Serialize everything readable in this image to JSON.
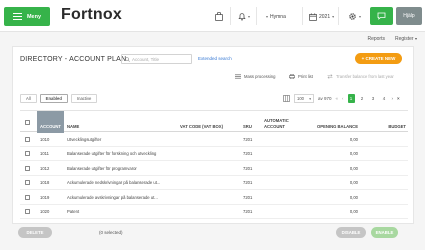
{
  "header": {
    "menu_label": "Meny",
    "logo": "Fortnox",
    "user": "Hymna",
    "year": "2021",
    "help_label": "Hjälp"
  },
  "sublinks": {
    "reports": "Reports",
    "register": "Register"
  },
  "page": {
    "title": "DIRECTORY - ACCOUNT PLAN",
    "search_placeholder": "Account, Title",
    "extended_search": "Extended search",
    "create_new": "+ CREATE NEW"
  },
  "actions": {
    "mass_processing": "Mass processing",
    "print_list": "Print list",
    "transfer_balance": "Transfer balance from last year"
  },
  "filters": [
    "All",
    "Enabled",
    "Inactive"
  ],
  "filter_selected": "Enabled",
  "pagination": {
    "per_page": "100",
    "of_total": "av 970",
    "pages": [
      "1",
      "2",
      "3",
      "4"
    ],
    "current": "1"
  },
  "table": {
    "columns": {
      "account": "ACCOUNT",
      "name": "NAME",
      "vat_code": "VAT CODE (VAT BOX)",
      "sru": "SRU",
      "automatic_account": "AUTOMATIC ACCOUNT",
      "opening_balance": "OPENING BALANCE",
      "budget": "BUDGET"
    },
    "rows": [
      {
        "account": "1010",
        "name": "Utvecklingsutgifter",
        "sru": "7201",
        "opening_balance": "0,00"
      },
      {
        "account": "1011",
        "name": "Balanserade utgifter för forskning och utveckling",
        "sru": "7201",
        "opening_balance": "0,00"
      },
      {
        "account": "1012",
        "name": "Balanserade utgifter för programvaror",
        "sru": "7201",
        "opening_balance": "0,00"
      },
      {
        "account": "1018",
        "name": "Ackumulerade nedskrivningar på balanserade ut...",
        "sru": "7201",
        "opening_balance": "0,00"
      },
      {
        "account": "1019",
        "name": "Ackumulerade avskrivningar på balanserade ut...",
        "sru": "7201",
        "opening_balance": "0,00"
      },
      {
        "account": "1020",
        "name": "Patent",
        "sru": "7201",
        "opening_balance": "0,00"
      }
    ]
  },
  "bottom": {
    "delete": "DELETE",
    "selected": "(0 selected)",
    "disable": "DISABLE",
    "enable": "ENABLE"
  },
  "colors": {
    "brand_green": "#36b34a",
    "accent_orange": "#f39c12",
    "sorted_header": "#8c9aa5",
    "disabled_pill": "#c5c5c5",
    "enable_pill": "#a8d8a0"
  }
}
